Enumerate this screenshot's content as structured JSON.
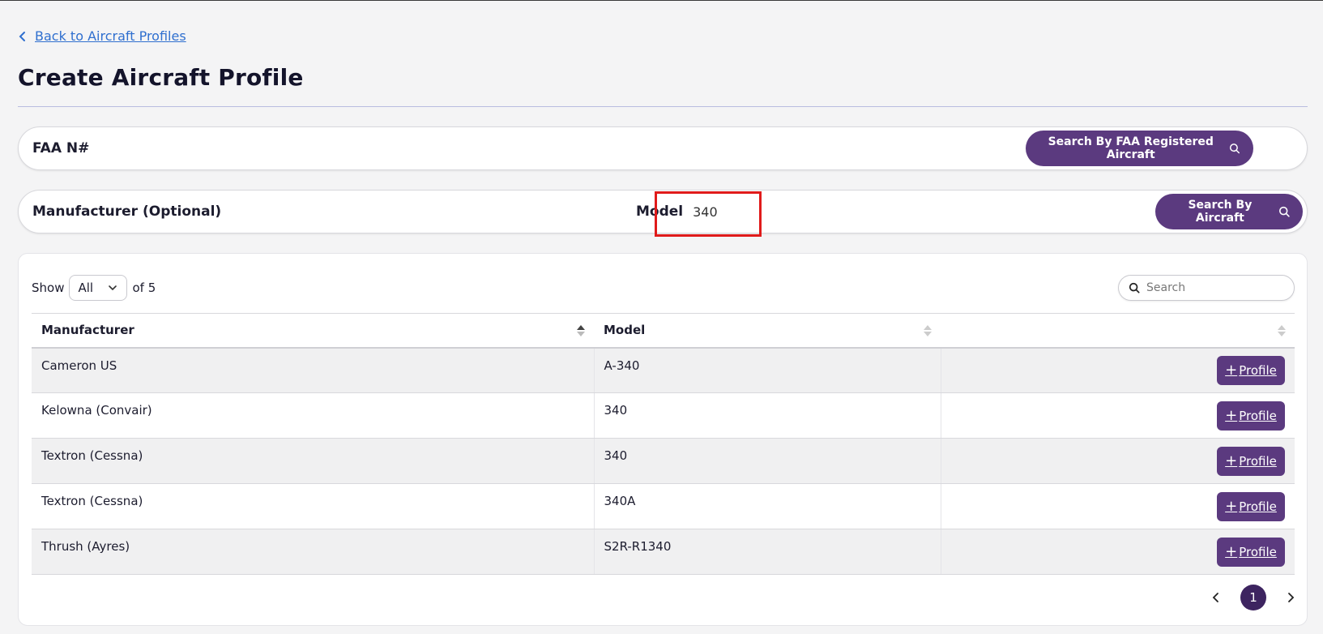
{
  "nav": {
    "back_label": "Back to Aircraft Profiles"
  },
  "page": {
    "title": "Create Aircraft Profile"
  },
  "faa_search": {
    "label": "FAA N#",
    "value": "",
    "button_label": "Search By FAA Registered Aircraft"
  },
  "aircraft_search": {
    "manufacturer_label": "Manufacturer (Optional)",
    "manufacturer_value": "",
    "model_label": "Model",
    "model_value": "340",
    "button_label": "Search By Aircraft"
  },
  "table_controls": {
    "show_label": "Show",
    "show_value": "All",
    "of_label": "of 5",
    "search_placeholder": "Search"
  },
  "table": {
    "columns": [
      "Manufacturer",
      "Model",
      ""
    ],
    "action_label": "Profile",
    "rows": [
      {
        "manufacturer": "Cameron US",
        "model": "A-340"
      },
      {
        "manufacturer": "Kelowna (Convair)",
        "model": "340"
      },
      {
        "manufacturer": "Textron (Cessna)",
        "model": "340"
      },
      {
        "manufacturer": "Textron (Cessna)",
        "model": "340A"
      },
      {
        "manufacturer": "Thrush (Ayres)",
        "model": "S2R-R1340"
      }
    ]
  },
  "pagination": {
    "current_page": "1"
  },
  "colors": {
    "accent": "#5b3a7f",
    "link": "#2f6fcf",
    "highlight": "#e01b1b"
  }
}
